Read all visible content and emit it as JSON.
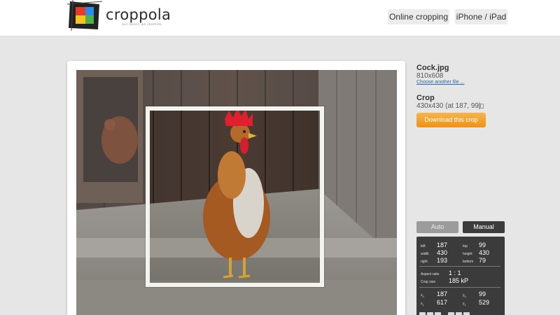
{
  "header": {
    "brand": "croppola",
    "tagline": "OUT SHOOT, WE CROPPED",
    "nav": {
      "online_cropping": "Online cropping",
      "iphone_ipad": "iPhone / iPad"
    }
  },
  "file": {
    "name": "Cock.jpg",
    "dimensions": "810x608",
    "choose_another": "Choose another file ..."
  },
  "crop": {
    "heading": "Crop",
    "info": "430x430 (at 187, 99)",
    "download_label": "Download this crop"
  },
  "tabs": {
    "auto": "Auto",
    "manual": "Manual"
  },
  "manual_panel": {
    "left_label": "left",
    "left_value": "187",
    "top_label": "top",
    "top_value": "99",
    "width_label": "width",
    "width_value": "430",
    "height_label": "height",
    "height_value": "430",
    "right_label": "right",
    "right_value": "193",
    "bottom_label": "bottom",
    "bottom_value": "79",
    "aspect_label": "Aspect ratio",
    "aspect_value": "1 : 1",
    "cropsize_label": "Crop size",
    "cropsize_value": "185 kP",
    "x0_label": "x",
    "x0_sub": "0",
    "x0_value": "187",
    "y0_label": "y",
    "y0_sub": "0",
    "y0_value": "99",
    "x1_label": "x",
    "x1_sub": "1",
    "x1_value": "617",
    "y1_label": "y",
    "y1_sub": "1",
    "y1_value": "529"
  },
  "colors": {
    "accent": "#ee9216",
    "link": "#2b6aa8",
    "panel_bg": "#3b3b3b",
    "page_bg": "#e6e6e6"
  }
}
